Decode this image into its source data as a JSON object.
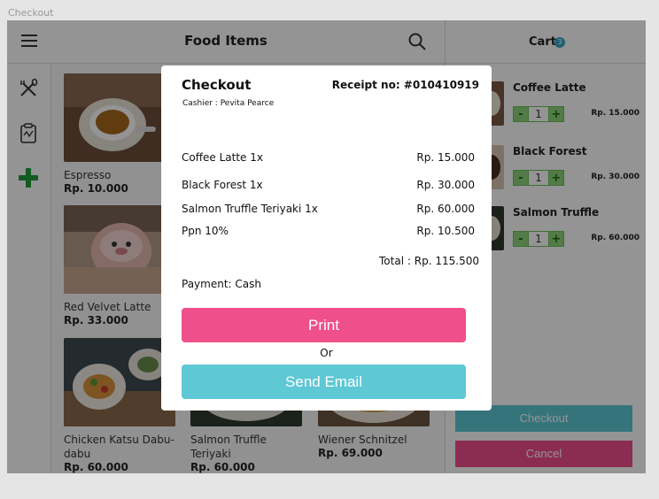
{
  "frame_label": "Checkout",
  "topbar": {
    "title": "Food Items"
  },
  "cart": {
    "title": "Cart",
    "count": "3"
  },
  "food_items": [
    {
      "name": "Espresso",
      "price": "Rp. 10.000"
    },
    {
      "name": "Red Velvet Latte",
      "price": "Rp. 33.000"
    },
    {
      "name": "Chicken Katsu Dabu-dabu",
      "price": "Rp. 60.000"
    },
    {
      "name": "Salmon Truffle Teriyaki",
      "price": "Rp. 60.000"
    },
    {
      "name": "Wiener Schnitzel",
      "price": "Rp. 69.000"
    }
  ],
  "cart_items": [
    {
      "name": "Coffee Latte",
      "qty": "1",
      "price": "Rp. 15.000"
    },
    {
      "name": "Black Forest",
      "qty": "1",
      "price": "Rp. 30.000"
    },
    {
      "name": "Salmon Truffle",
      "qty": "1",
      "price": "Rp. 60.000"
    }
  ],
  "cart_buttons": {
    "checkout": "Checkout",
    "cancel": "Cancel"
  },
  "modal": {
    "title": "Checkout",
    "receipt": "Receipt no: #010410919",
    "cashier_label": "Cashier :",
    "cashier_name": "Pevita Pearce",
    "lines": [
      {
        "label": "Coffee Latte 1x",
        "value": "Rp. 15.000"
      },
      {
        "label": "Black Forest 1x",
        "value": "Rp. 30.000"
      },
      {
        "label": "Salmon Truffle Teriyaki 1x",
        "value": "Rp. 60.000"
      },
      {
        "label": "Ppn 10%",
        "value": "Rp. 10.500"
      }
    ],
    "total_label": "Total :",
    "total_value": "Rp. 115.500",
    "payment": "Payment: Cash",
    "print_label": "Print",
    "or_label": "Or",
    "email_label": "Send Email"
  },
  "colors": {
    "accent_pink": "#ef4f8a",
    "accent_teal": "#5ec8d4",
    "stepper_green": "#8dd47c"
  }
}
